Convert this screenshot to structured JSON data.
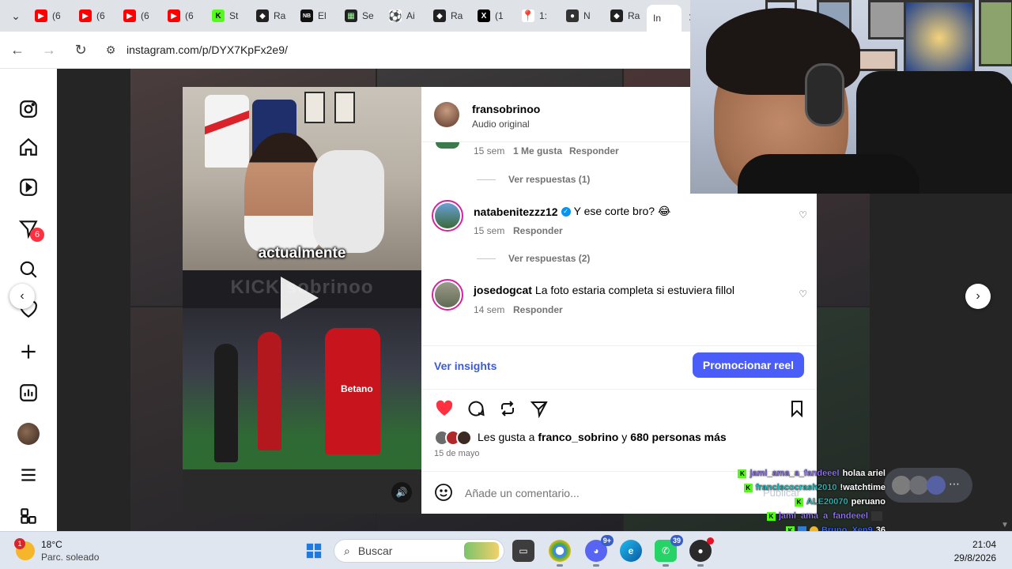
{
  "browser": {
    "tabs": [
      {
        "label": "(6",
        "icon": "youtube-icon",
        "color": "#ff0000"
      },
      {
        "label": "(6",
        "icon": "youtube-icon",
        "color": "#ff0000"
      },
      {
        "label": "(6",
        "icon": "youtube-icon",
        "color": "#ff0000"
      },
      {
        "label": "(6",
        "icon": "youtube-icon",
        "color": "#ff0000"
      },
      {
        "label": "St",
        "icon": "kick-icon",
        "color": "#53fc18"
      },
      {
        "label": "Ra",
        "icon": "shield-icon",
        "color": "#222222"
      },
      {
        "label": "El",
        "icon": "news-icon",
        "color": "#111111"
      },
      {
        "label": "Se",
        "icon": "grid-icon",
        "color": "#222222"
      },
      {
        "label": "Ai",
        "icon": "soccer-ball-icon",
        "color": "#333333"
      },
      {
        "label": "Ra",
        "icon": "shield-icon",
        "color": "#222222"
      },
      {
        "label": "(1",
        "icon": "x-icon",
        "color": "#000000"
      },
      {
        "label": "1:",
        "icon": "maps-icon",
        "color": "#34a853"
      },
      {
        "label": "N",
        "icon": "github-icon",
        "color": "#333333"
      },
      {
        "label": "Ra",
        "icon": "shield-icon",
        "color": "#222222"
      }
    ],
    "active_tab": {
      "label": "In",
      "close": "✕"
    },
    "url": "instagram.com/p/DYX7KpFx2e9/"
  },
  "sidebar": {
    "notification_count": "6"
  },
  "post": {
    "author": "fransobrinoo",
    "audio": "Audio original",
    "video_caption": "actualmente",
    "video_watermark": "KICK sobrinoo",
    "sponsor": "Betano",
    "comments": [
      {
        "partial": true,
        "time": "15 sem",
        "likes": "1 Me gusta",
        "reply": "Responder",
        "view_replies": "Ver respuestas (1)"
      },
      {
        "user": "natabenitezzz12",
        "verified": true,
        "text": "Y ese corte bro? 😂",
        "time": "15 sem",
        "reply": "Responder",
        "view_replies": "Ver respuestas (2)"
      },
      {
        "user": "josedogcat",
        "verified": false,
        "text": "La foto estaria completa si estuviera fillol",
        "time": "14 sem",
        "reply": "Responder"
      }
    ],
    "insights": "Ver insights",
    "promote": "Promocionar reel",
    "likes_prefix": "Les gusta a",
    "likes_user": "franco_sobrino",
    "likes_conj": "y",
    "likes_rest": "680 personas más",
    "date": "15 de mayo",
    "comment_placeholder": "Añade un comentario..."
  },
  "stream_chat": [
    {
      "user": "jami_ama_a_fandeeel",
      "msg": "holaa ariel"
    },
    {
      "user": "franciscocrash2010",
      "msg": "!watchtime"
    },
    {
      "user": "ALE20070",
      "msg": "peruano"
    },
    {
      "user": "jami_ama_a_fandeeel",
      "msg": ""
    },
    {
      "user": "Bruno_Xen9",
      "msg": "36"
    }
  ],
  "publish_ghost": "Publicar",
  "taskbar": {
    "temp": "18°C",
    "weather": "Parc. soleado",
    "weather_badge": "1",
    "search": "Buscar",
    "discord_badge": "9+",
    "whatsapp_badge": "39",
    "time": "21:04",
    "date": "29/8/2026"
  },
  "colors": {
    "instagram_blue": "#4a5df9",
    "heart_red": "#ff3040",
    "kick_green": "#53fc18"
  }
}
